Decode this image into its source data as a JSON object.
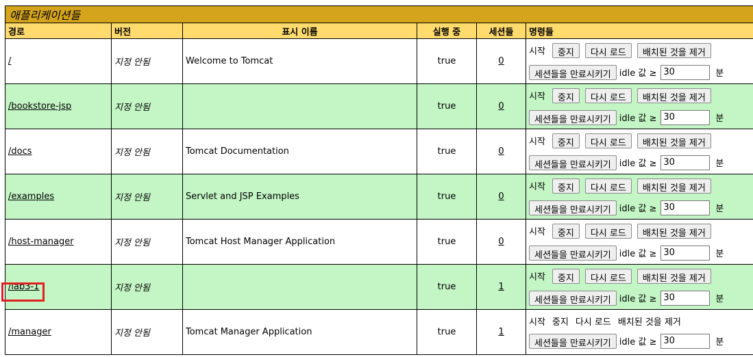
{
  "section_title": "애플리케이션들",
  "columns": {
    "path": "경로",
    "version": "버전",
    "display_name": "표시 이름",
    "running": "실행 중",
    "sessions": "세션들",
    "commands": "명령들"
  },
  "commands": {
    "start": "시작",
    "stop": "중지",
    "reload": "다시 로드",
    "undeploy": "배치된 것을 제거",
    "expire": "세션들을 만료시키기",
    "idle_label": "idle 값 ≥",
    "minutes": "분"
  },
  "apps": [
    {
      "path": "/",
      "version": "지정 안됨",
      "display_name": "Welcome to Tomcat",
      "running": "true",
      "sessions": "0",
      "idle": "30"
    },
    {
      "path": "/bookstore-jsp",
      "version": "지정 안됨",
      "display_name": "",
      "running": "true",
      "sessions": "0",
      "idle": "30"
    },
    {
      "path": "/docs",
      "version": "지정 안됨",
      "display_name": "Tomcat Documentation",
      "running": "true",
      "sessions": "0",
      "idle": "30"
    },
    {
      "path": "/examples",
      "version": "지정 안됨",
      "display_name": "Servlet and JSP Examples",
      "running": "true",
      "sessions": "0",
      "idle": "30"
    },
    {
      "path": "/host-manager",
      "version": "지정 안됨",
      "display_name": "Tomcat Host Manager Application",
      "running": "true",
      "sessions": "0",
      "idle": "30"
    },
    {
      "path": "/lab3-1",
      "version": "지정 안됨",
      "display_name": "",
      "running": "true",
      "sessions": "1",
      "idle": "30"
    },
    {
      "path": "/manager",
      "version": "지정 안됨",
      "display_name": "Tomcat Manager Application",
      "running": "true",
      "sessions": "1",
      "idle": "30"
    }
  ],
  "highlight_color": "#e02020"
}
